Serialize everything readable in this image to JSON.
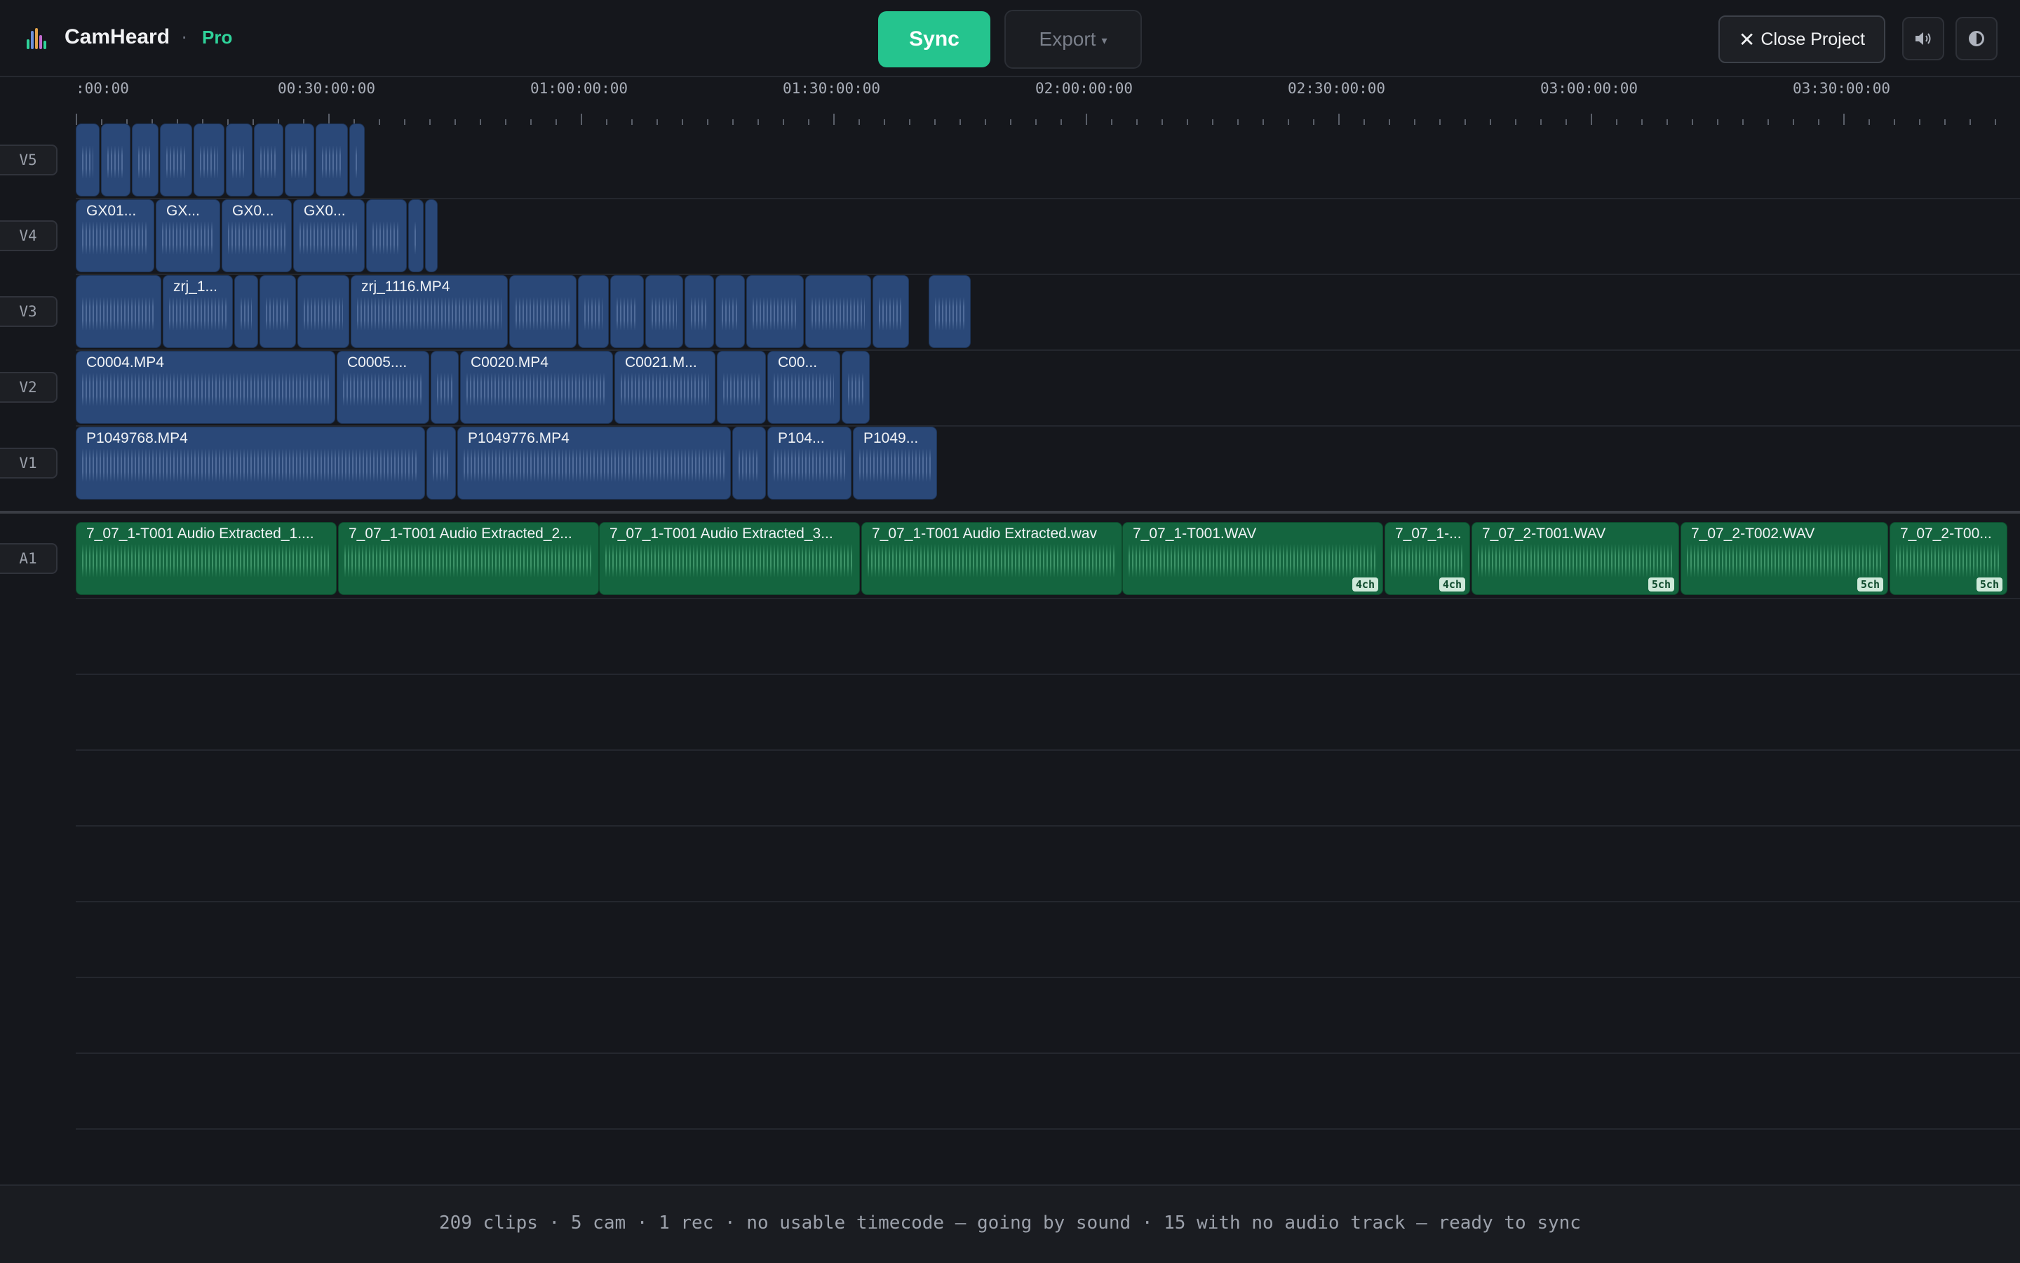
{
  "app": {
    "name": "CamHeard",
    "separator": "·",
    "tier": "Pro"
  },
  "toolbar": {
    "sync_label": "Sync",
    "export_label": "Export",
    "close_label": "Close Project",
    "volume_icon": "speaker-icon",
    "theme_icon": "contrast-icon"
  },
  "ruler": {
    "labels": [
      ":00:00",
      "00:30:00:00",
      "01:00:00:00",
      "01:30:00:00",
      "02:00:00:00",
      "02:30:00:00",
      "03:00:00:00",
      "03:30:00:00"
    ]
  },
  "tracks": {
    "V5": {
      "label": "V5",
      "clips": [
        {
          "name": ""
        },
        {
          "name": ""
        },
        {
          "name": ""
        },
        {
          "name": ""
        },
        {
          "name": ""
        },
        {
          "name": ""
        },
        {
          "name": ""
        },
        {
          "name": ""
        },
        {
          "name": ""
        },
        {
          "name": ""
        }
      ]
    },
    "V4": {
      "label": "V4",
      "clips": [
        {
          "name": "GX01..."
        },
        {
          "name": "GX..."
        },
        {
          "name": "GX0..."
        },
        {
          "name": "GX0..."
        },
        {
          "name": ""
        },
        {
          "name": ""
        },
        {
          "name": ""
        }
      ]
    },
    "V3": {
      "label": "V3",
      "clips": [
        {
          "name": ""
        },
        {
          "name": "zrj_1..."
        },
        {
          "name": ""
        },
        {
          "name": ""
        },
        {
          "name": ""
        },
        {
          "name": "zrj_1116.MP4"
        },
        {
          "name": ""
        },
        {
          "name": ""
        },
        {
          "name": ""
        },
        {
          "name": ""
        },
        {
          "name": ""
        },
        {
          "name": ""
        },
        {
          "name": ""
        },
        {
          "name": ""
        },
        {
          "name": ""
        },
        {
          "name": ""
        }
      ]
    },
    "V2": {
      "label": "V2",
      "clips": [
        {
          "name": "C0004.MP4"
        },
        {
          "name": "C0005...."
        },
        {
          "name": ""
        },
        {
          "name": "C0020.MP4"
        },
        {
          "name": "C0021.M..."
        },
        {
          "name": ""
        },
        {
          "name": "C00..."
        },
        {
          "name": ""
        }
      ]
    },
    "V1": {
      "label": "V1",
      "clips": [
        {
          "name": "P1049768.MP4"
        },
        {
          "name": ""
        },
        {
          "name": "P1049776.MP4"
        },
        {
          "name": ""
        },
        {
          "name": "P104..."
        },
        {
          "name": "P1049..."
        }
      ]
    },
    "A1": {
      "label": "A1",
      "clips": [
        {
          "name": "7_07_1-T001 Audio Extracted_1....",
          "channels": ""
        },
        {
          "name": "7_07_1-T001 Audio Extracted_2...",
          "channels": ""
        },
        {
          "name": "7_07_1-T001 Audio Extracted_3...",
          "channels": ""
        },
        {
          "name": "7_07_1-T001 Audio Extracted.wav",
          "channels": ""
        },
        {
          "name": "7_07_1-T001.WAV",
          "channels": "4ch"
        },
        {
          "name": "7_07_1-...",
          "channels": "4ch"
        },
        {
          "name": "7_07_2-T001.WAV",
          "channels": "5ch"
        },
        {
          "name": "7_07_2-T002.WAV",
          "channels": "5ch"
        },
        {
          "name": "7_07_2-T00...",
          "channels": "5ch"
        }
      ]
    }
  },
  "status": {
    "text": "209 clips · 5 cam · 1 rec · no usable timecode — going by sound · 15 with no audio track — ready to sync"
  },
  "colors": {
    "accent": "#25c48e",
    "video_clip": "#2a4878",
    "audio_clip": "#14653f",
    "background": "#15171c"
  }
}
